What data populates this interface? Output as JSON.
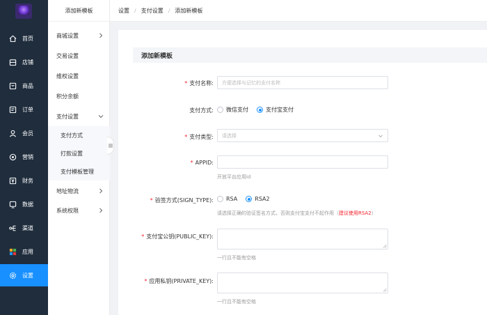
{
  "nav": {
    "items": [
      {
        "label": "首页",
        "icon": "home-icon"
      },
      {
        "label": "店铺",
        "icon": "shop-icon"
      },
      {
        "label": "商品",
        "icon": "goods-icon"
      },
      {
        "label": "订单",
        "icon": "order-icon"
      },
      {
        "label": "会员",
        "icon": "user-icon"
      },
      {
        "label": "营销",
        "icon": "marketing-icon"
      },
      {
        "label": "财务",
        "icon": "finance-icon"
      },
      {
        "label": "数据",
        "icon": "data-icon"
      },
      {
        "label": "渠道",
        "icon": "channel-icon"
      },
      {
        "label": "应用",
        "icon": "apps-icon"
      },
      {
        "label": "设置",
        "icon": "settings-icon"
      }
    ],
    "active_index": 10,
    "active_color": "#1890ff"
  },
  "sub": {
    "title": "添加新模板",
    "items": [
      {
        "label": "商城设置"
      },
      {
        "label": "交易设置"
      },
      {
        "label": "维权设置"
      },
      {
        "label": "积分余额"
      },
      {
        "label": "支付设置"
      },
      {
        "label": "支付方式"
      },
      {
        "label": "打款设置"
      },
      {
        "label": "支付模板管理"
      },
      {
        "label": "地址物流"
      },
      {
        "label": "系统权限"
      }
    ]
  },
  "breadcrumb": {
    "items": [
      "设置",
      "支付设置",
      "添加新模板"
    ]
  },
  "form": {
    "section_title": "添加新模板",
    "name": {
      "label": "支付名称:",
      "placeholder": "方便选择与记忆的支付名称"
    },
    "method": {
      "label": "支付方式:",
      "options": [
        "微信支付",
        "支付宝支付"
      ],
      "selected": 1
    },
    "type": {
      "label": "支付类型:",
      "placeholder": "请选择"
    },
    "appid": {
      "label": "APPID:",
      "hint": "开放平台应用id"
    },
    "sign": {
      "label": "验签方式(SIGN_TYPE):",
      "options": [
        "RSA",
        "RSA2"
      ],
      "selected": 1,
      "hint": "请选择正确的验证签名方式，否则支付宝支付不起作用（",
      "hint_red": "建议使用RSA2",
      "hint_end": "）"
    },
    "public_key": {
      "label": "支付宝公钥(PUBLIC_KEY):",
      "hint": "一行且不能有空格"
    },
    "private_key": {
      "label": "应用私钥(PRIVATE_KEY):",
      "hint": "一行且不能有空格"
    }
  }
}
